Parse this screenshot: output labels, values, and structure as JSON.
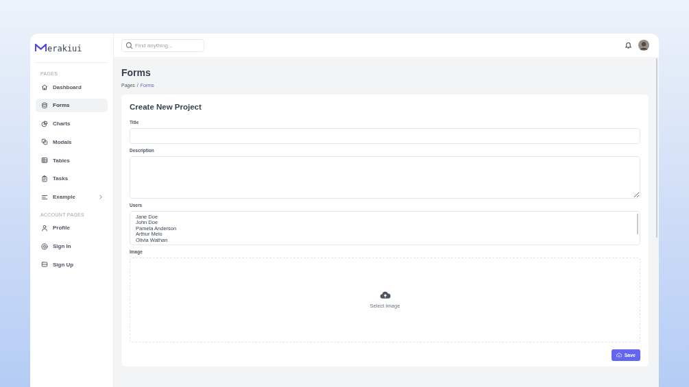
{
  "brand": {
    "name": "erakiui"
  },
  "search": {
    "placeholder": "Find anything..."
  },
  "sidebar": {
    "sections": [
      {
        "title": "PAGES",
        "items": [
          {
            "label": "Dashboard",
            "selected": false,
            "has_submenu": false
          },
          {
            "label": "Forms",
            "selected": true,
            "has_submenu": false
          },
          {
            "label": "Charts",
            "selected": false,
            "has_submenu": false
          },
          {
            "label": "Modals",
            "selected": false,
            "has_submenu": false
          },
          {
            "label": "Tables",
            "selected": false,
            "has_submenu": false
          },
          {
            "label": "Tasks",
            "selected": false,
            "has_submenu": false
          },
          {
            "label": "Example",
            "selected": false,
            "has_submenu": true
          }
        ]
      },
      {
        "title": "ACCOUNT PAGES",
        "items": [
          {
            "label": "Profile",
            "selected": false,
            "has_submenu": false
          },
          {
            "label": "Sign In",
            "selected": false,
            "has_submenu": false
          },
          {
            "label": "Sign Up",
            "selected": false,
            "has_submenu": false
          }
        ]
      }
    ]
  },
  "page": {
    "title": "Forms",
    "breadcrumb": [
      {
        "label": "Pages",
        "current": false
      },
      {
        "label": "/",
        "current": false
      },
      {
        "label": "Forms",
        "current": true
      }
    ]
  },
  "form": {
    "title": "Create New Project",
    "fields": [
      {
        "kind": "text",
        "label": "Title"
      },
      {
        "kind": "textarea",
        "label": "Description"
      },
      {
        "kind": "list",
        "label": "Users",
        "options": [
          "Jane Doe",
          "John Doe",
          "Pamela Anderson",
          "Arthur Melo",
          "Olivia Wathan"
        ]
      },
      {
        "kind": "upload",
        "label": "Image",
        "prompt": "Select Image"
      }
    ],
    "submit": "Save"
  }
}
